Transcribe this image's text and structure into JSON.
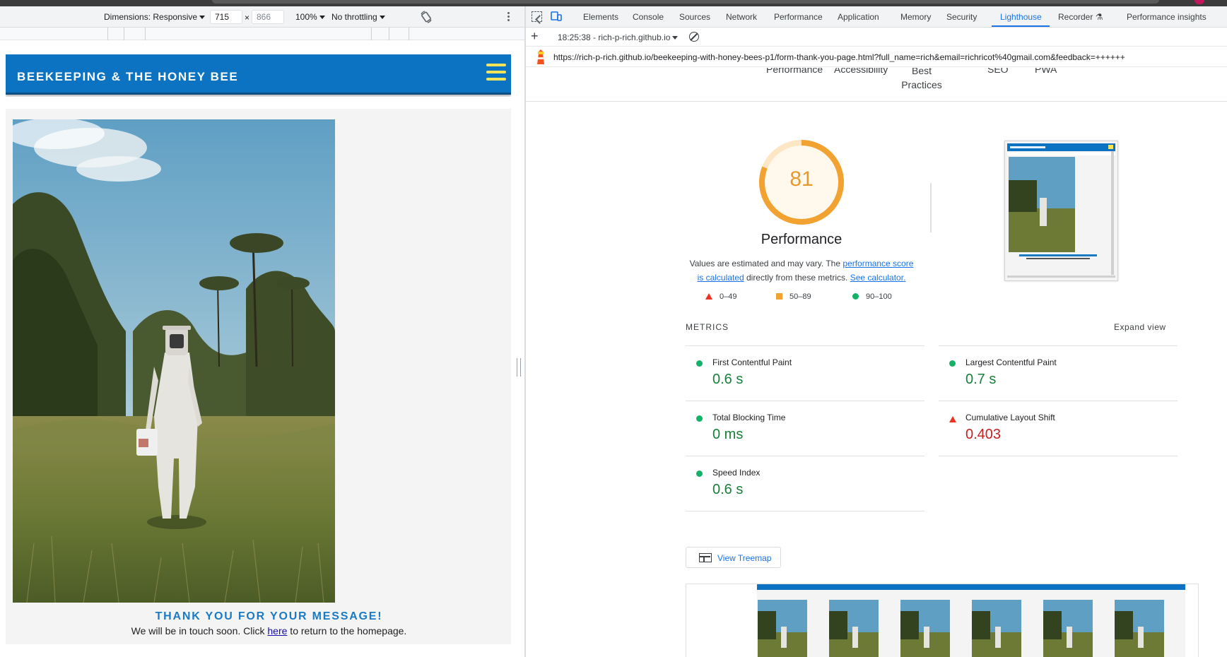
{
  "device_toolbar": {
    "dimensions_label": "Dimensions: Responsive",
    "width_value": "715",
    "times": "×",
    "height_value": "866",
    "zoom": "100%",
    "throttling": "No throttling"
  },
  "site": {
    "title": "BEEKEEPING & THE HONEY BEE",
    "thanks_heading": "THANK YOU FOR YOUR MESSAGE!",
    "thanks_before_link": "We will be in touch soon. Click ",
    "thanks_link": "here",
    "thanks_after_link": " to return to the homepage."
  },
  "devtools": {
    "tabs": [
      "Elements",
      "Console",
      "Sources",
      "Network",
      "Performance",
      "Application",
      "Memory",
      "Security",
      "Lighthouse",
      "Recorder",
      "Performance insights"
    ],
    "active_tab": "Lighthouse",
    "report_select": "18:25:38 - rich-p-rich.github.io",
    "url": "https://rich-p-rich.github.io/beekeeping-with-honey-bees-p1/form-thank-you-page.html?full_name=rich&email=richricot%40gmail.com&feedback=++++++"
  },
  "lighthouse": {
    "category_nav": [
      "Performance",
      "Accessibility",
      "Best Practices",
      "SEO",
      "PWA"
    ],
    "score": "81",
    "score_fraction": 0.81,
    "title": "Performance",
    "desc_before": "Values are estimated and may vary. The ",
    "desc_link1": "performance score is calculated",
    "desc_middle": " directly from these metrics. ",
    "desc_link2": "See calculator.",
    "legend": [
      "0–49",
      "50–89",
      "90–100"
    ],
    "metrics_heading": "METRICS",
    "expand_view": "Expand view",
    "metrics": [
      {
        "name": "First Contentful Paint",
        "value": "0.6 s",
        "status": "good"
      },
      {
        "name": "Largest Contentful Paint",
        "value": "0.7 s",
        "status": "good"
      },
      {
        "name": "Total Blocking Time",
        "value": "0 ms",
        "status": "good"
      },
      {
        "name": "Cumulative Layout Shift",
        "value": "0.403",
        "status": "poor"
      },
      {
        "name": "Speed Index",
        "value": "0.6 s",
        "status": "good"
      }
    ],
    "treemap_button": "View Treemap"
  },
  "colors": {
    "site_header": "#0c72c2",
    "hamburger": "#f5e35a",
    "thanks_heading": "#1a7bc4",
    "score_orange": "#f2a230",
    "good_green": "#12b368",
    "poor_red": "#eb3323",
    "devtools_accent": "#1a73e8"
  }
}
